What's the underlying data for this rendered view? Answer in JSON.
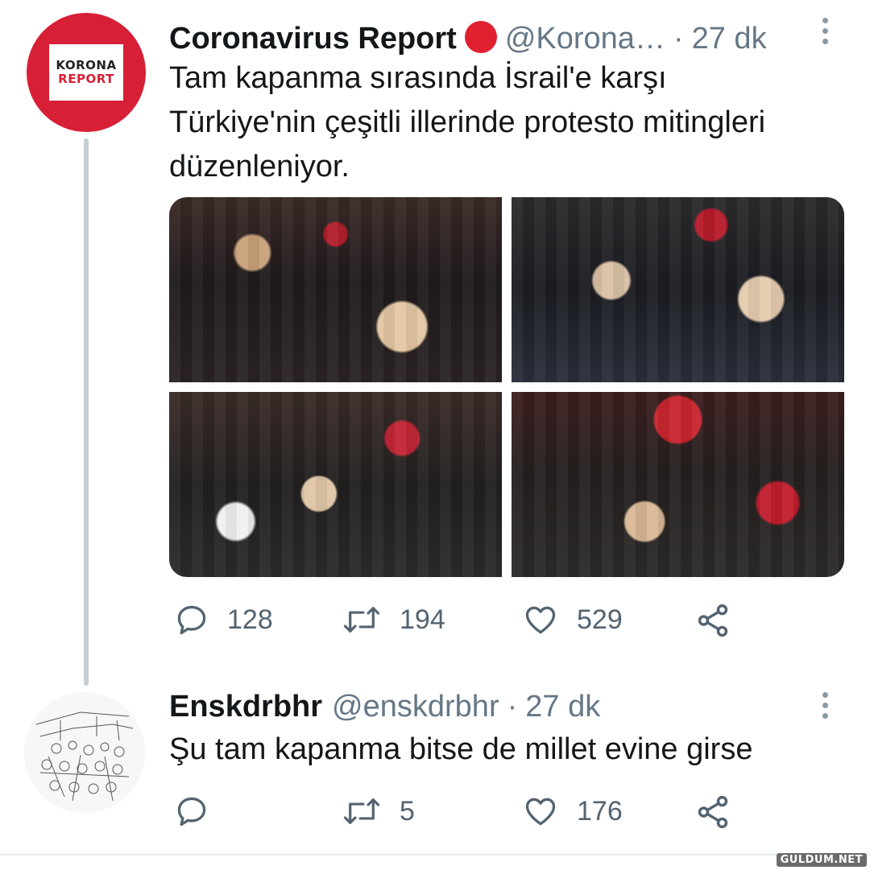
{
  "tweets": [
    {
      "avatar_text": [
        "KORONA",
        "REPORT"
      ],
      "name": "Coronavirus Report",
      "handle": "@Korona…",
      "separator": "·",
      "time": "27 dk",
      "text_lines": [
        "Tam kapanma sırasında İsrail'e karşı",
        "Türkiye'nin çeşitli illerinde protesto mitingleri",
        "düzenleniyor."
      ],
      "replies": "128",
      "retweets": "194",
      "likes": "529"
    },
    {
      "name": "Enskdrbhr",
      "handle": "@enskdrbhr",
      "separator": "·",
      "time": "27 dk",
      "text_lines": [
        "Şu tam kapanma bitse de millet evine girse"
      ],
      "replies": "",
      "retweets": "5",
      "likes": "176"
    }
  ],
  "watermark": "GULDUM.NET",
  "colors": {
    "verified_badge": "#e0202f",
    "korona_brand": "#d71f35",
    "secondary_text": "#657786",
    "icon_gray": "#536471"
  },
  "icons": [
    "reply-icon",
    "retweet-icon",
    "like-icon",
    "share-icon",
    "more-icon"
  ]
}
